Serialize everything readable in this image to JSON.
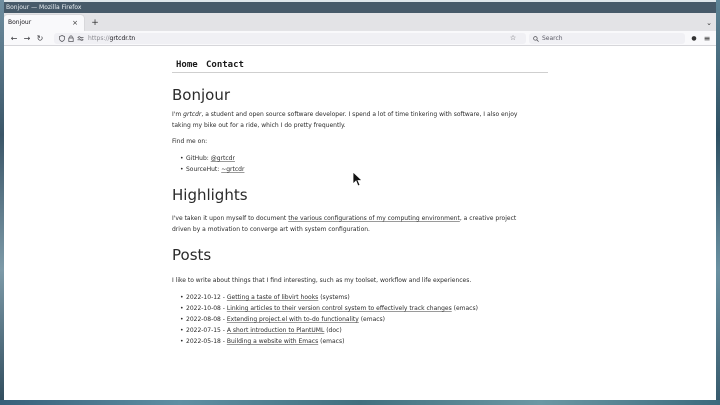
{
  "window": {
    "title": "Bonjour — Mozilla Firefox"
  },
  "tabs": [
    {
      "label": "Bonjour",
      "close_icon": "×"
    }
  ],
  "tabstrip": {
    "new_tab_icon": "+",
    "list_all_tabs_icon": "⌄"
  },
  "toolbar": {
    "back_icon": "←",
    "forward_icon": "→",
    "reload_icon": "↻",
    "url_scheme": "https://",
    "url_host": "grtcdr.tn",
    "search_placeholder": "Search"
  },
  "site_nav": {
    "home": "Home",
    "contact": "Contact"
  },
  "bonjour": {
    "heading": "Bonjour",
    "intro_prefix": "I'm ",
    "intro_name": "grtcdr",
    "intro_rest": ", a student and open source software developer. I spend a lot of time tinkering with software, I also enjoy taking my bike out for a ride, which I do pretty frequently.",
    "find_me": "Find me on:",
    "links": [
      {
        "label": "GitHub: ",
        "handle": "@grtcdr"
      },
      {
        "label": "SourceHut: ",
        "handle": "~grtcdr"
      }
    ]
  },
  "highlights": {
    "heading": "Highlights",
    "text_before": "I've taken it upon myself to document ",
    "link_text": "the various configurations of my computing environment",
    "text_after": ", a creative project driven by a motivation to converge art with system configuration."
  },
  "posts": {
    "heading": "Posts",
    "intro": "I like to write about things that I find interesting, such as my toolset, workflow and life experiences.",
    "items": [
      {
        "date": "2022-10-12 - ",
        "title": "Getting a taste of libvirt hooks",
        "tag": " (systems)"
      },
      {
        "date": "2022-10-08 - ",
        "title": "Linking articles to their version control system to effectively track changes",
        "tag": " (emacs)"
      },
      {
        "date": "2022-08-08 - ",
        "title": "Extending project.el with to-do functionality",
        "tag": " (emacs)"
      },
      {
        "date": "2022-07-15 - ",
        "title": "A short introduction to PlantUML",
        "tag": " (doc)"
      },
      {
        "date": "2022-05-18 - ",
        "title": "Building a website with Emacs",
        "tag": " (emacs)"
      }
    ]
  }
}
